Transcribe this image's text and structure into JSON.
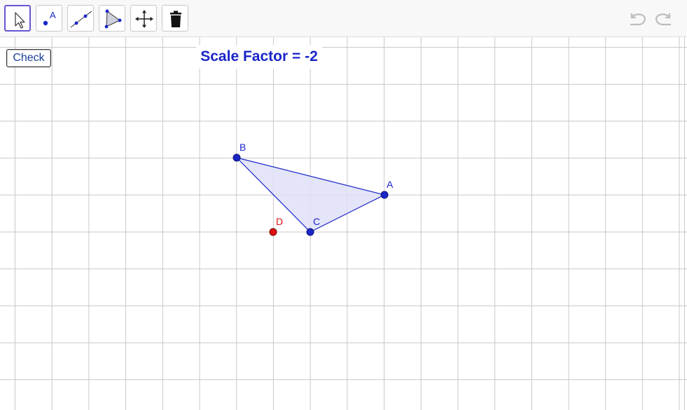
{
  "toolbar": {
    "tools": [
      {
        "name": "move-tool",
        "icon": "arrow-cursor-icon",
        "selected": true
      },
      {
        "name": "point-tool",
        "icon": "point-icon",
        "icon_text": "A"
      },
      {
        "name": "line-tool",
        "icon": "line-icon"
      },
      {
        "name": "polygon-tool",
        "icon": "polygon-icon"
      },
      {
        "name": "move-graphics-view-tool",
        "icon": "move-arrows-icon"
      },
      {
        "name": "delete-tool",
        "icon": "trash-icon"
      }
    ],
    "undo_icon": "undo-icon",
    "redo_icon": "redo-icon"
  },
  "check_button": {
    "label": "Check"
  },
  "scale_factor_text": "Scale Factor = -2",
  "points": [
    {
      "name": "A",
      "color": "#1a26c8"
    },
    {
      "name": "B",
      "color": "#1a26c8"
    },
    {
      "name": "C",
      "color": "#1a26c8"
    },
    {
      "name": "D",
      "color": "#dd1111"
    }
  ],
  "colors": {
    "point_blue": "#1a26c8",
    "point_red": "#dd1111",
    "polygon_fill": "#dfe0f8",
    "grid": "#c8c8c8",
    "selected_tool_border": "#6557d2"
  }
}
